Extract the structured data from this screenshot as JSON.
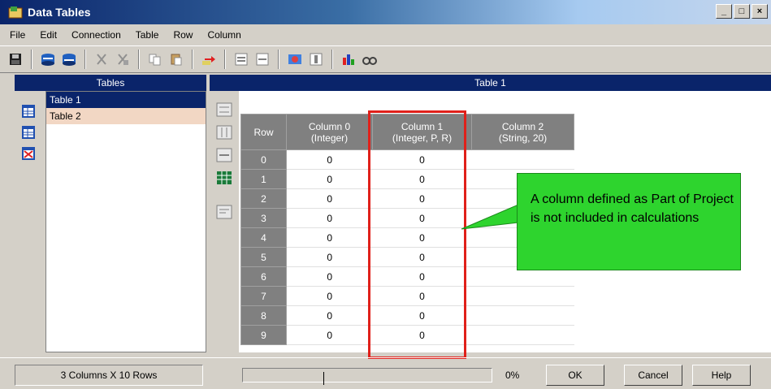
{
  "window": {
    "title": "Data Tables",
    "controls": [
      "_",
      "□",
      "×"
    ]
  },
  "menu": [
    "File",
    "Edit",
    "Connection",
    "Table",
    "Row",
    "Column"
  ],
  "toolbar": {
    "icons": [
      "save-icon",
      "table-add-icon",
      "table-remove-icon",
      "cut-icon",
      "cut-disabled-icon",
      "copy-icon",
      "paste-icon",
      "export-icon",
      "row-insert-icon",
      "row-delete-icon",
      "column-icon",
      "column-delete-icon",
      "chart-icon",
      "find-icon"
    ]
  },
  "tables_panel": {
    "header": "Tables",
    "items": [
      "Table 1",
      "Table 2"
    ],
    "icons": [
      "table-icon",
      "table-icon",
      "table-delete-icon"
    ]
  },
  "table_panel": {
    "header": "Table 1",
    "columns": [
      {
        "name": "Row",
        "type": ""
      },
      {
        "name": "Column 0",
        "type": "(Integer)"
      },
      {
        "name": "Column 1",
        "type": "(Integer, P, R)"
      },
      {
        "name": "Column 2",
        "type": "(String, 20)"
      }
    ],
    "rows": [
      {
        "row": "0",
        "c0": "0",
        "c1": "0",
        "c2": ""
      },
      {
        "row": "1",
        "c0": "0",
        "c1": "0",
        "c2": ""
      },
      {
        "row": "2",
        "c0": "0",
        "c1": "0",
        "c2": ""
      },
      {
        "row": "3",
        "c0": "0",
        "c1": "0",
        "c2": ""
      },
      {
        "row": "4",
        "c0": "0",
        "c1": "0",
        "c2": ""
      },
      {
        "row": "5",
        "c0": "0",
        "c1": "0",
        "c2": ""
      },
      {
        "row": "6",
        "c0": "0",
        "c1": "0",
        "c2": ""
      },
      {
        "row": "7",
        "c0": "0",
        "c1": "0",
        "c2": ""
      },
      {
        "row": "8",
        "c0": "0",
        "c1": "0",
        "c2": ""
      },
      {
        "row": "9",
        "c0": "0",
        "c1": "0",
        "c2": ""
      }
    ]
  },
  "callout": {
    "text": "A column defined as Part of Project is not included in calculations"
  },
  "status": {
    "summary": "3 Columns X 10 Rows",
    "progress_pct": "0%",
    "progress_value": 0
  },
  "buttons": {
    "ok": "OK",
    "cancel": "Cancel",
    "help": "Help"
  },
  "colors": {
    "titlebar": "#0a246a",
    "highlight": "#e0201a",
    "callout": "#2ed42e",
    "row2_selection": "#f2d7c4"
  }
}
